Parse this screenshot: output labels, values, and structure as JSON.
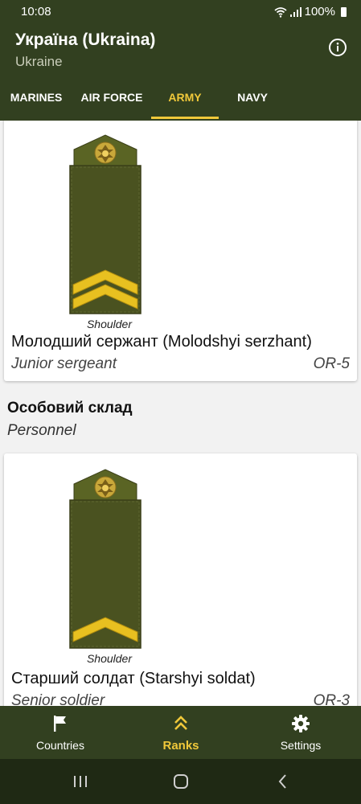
{
  "status": {
    "time": "10:08",
    "battery": "100%"
  },
  "appbar": {
    "title": "Україна (Ukraina)",
    "subtitle": "Ukraine"
  },
  "tabs": [
    {
      "label": "MARINES",
      "active": false
    },
    {
      "label": "AIR FORCE",
      "active": false
    },
    {
      "label": "ARMY",
      "active": true
    },
    {
      "label": "NAVY",
      "active": false
    }
  ],
  "cards": [
    {
      "caption": "Shoulder",
      "native": "Молодший сержант (Molodshyi serzhant)",
      "english": "Junior sergeant",
      "code": "OR-5",
      "chevrons": 2
    },
    {
      "caption": "Shoulder",
      "native": "Старший солдат (Starshyi soldat)",
      "english": "Senior soldier",
      "code": "OR-3",
      "chevrons": 1
    }
  ],
  "section": {
    "title": "Особовий склад",
    "subtitle": "Personnel"
  },
  "bottom_nav": [
    {
      "label": "Countries",
      "icon": "flag-icon",
      "active": false
    },
    {
      "label": "Ranks",
      "icon": "chevrons-up-icon",
      "active": true
    },
    {
      "label": "Settings",
      "icon": "gear-icon",
      "active": false
    }
  ],
  "colors": {
    "bar": "#324020",
    "accent": "#f0c83a",
    "strap": "#4a5220"
  }
}
